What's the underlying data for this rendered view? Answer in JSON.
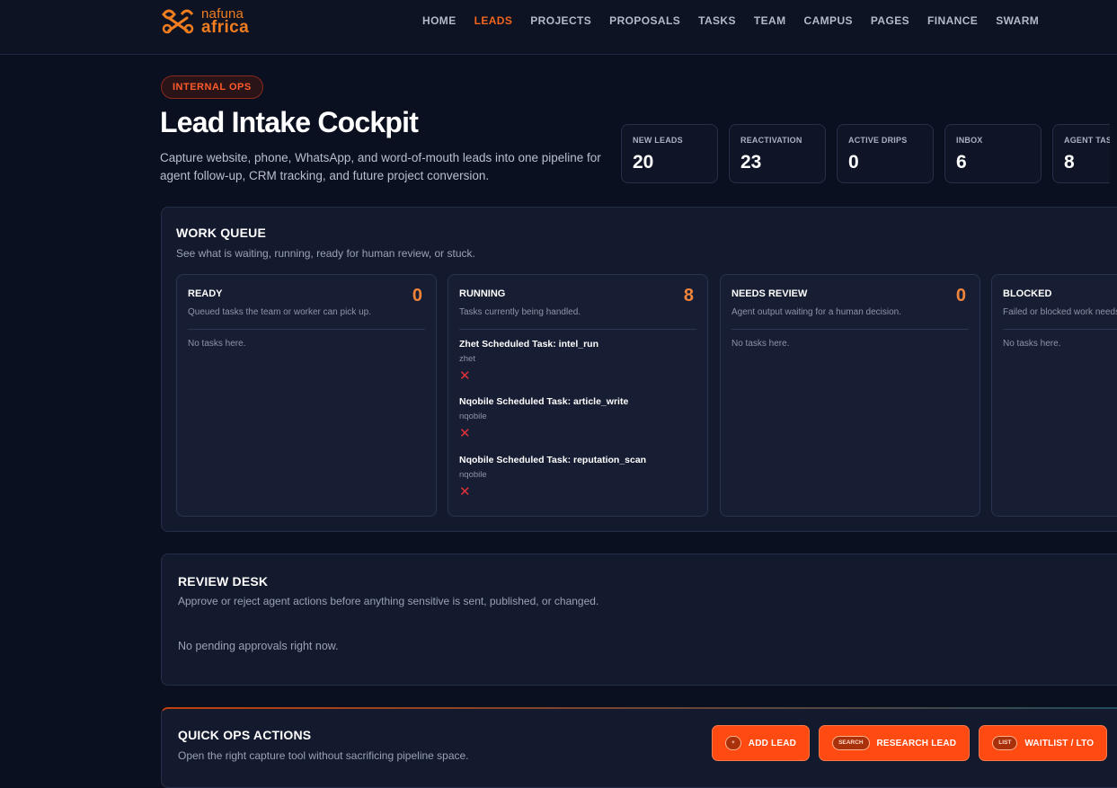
{
  "brand": {
    "line1": "nafuna",
    "line2": "africa",
    "accent": "#f07d1f",
    "icon": "nafuna-logo-icon"
  },
  "nav": {
    "items": [
      {
        "label": "HOME"
      },
      {
        "label": "LEADS",
        "active": true
      },
      {
        "label": "PROJECTS"
      },
      {
        "label": "PROPOSALS"
      },
      {
        "label": "TASKS"
      },
      {
        "label": "TEAM"
      },
      {
        "label": "CAMPUS"
      },
      {
        "label": "PAGES"
      },
      {
        "label": "FINANCE"
      },
      {
        "label": "SWARM"
      }
    ],
    "active_color": "#f0641e"
  },
  "hero": {
    "badge": "INTERNAL OPS",
    "title": "Lead Intake Cockpit",
    "subtitle": "Capture website, phone, WhatsApp, and word-of-mouth leads into one pipeline for agent follow-up, CRM tracking, and future project conversion."
  },
  "stats": [
    {
      "label": "NEW LEADS",
      "value": "20"
    },
    {
      "label": "REACTIVATION",
      "value": "23"
    },
    {
      "label": "ACTIVE DRIPS",
      "value": "0"
    },
    {
      "label": "INBOX",
      "value": "6"
    },
    {
      "label": "AGENT TASKS",
      "value": "8"
    }
  ],
  "work_queue": {
    "title": "WORK QUEUE",
    "description": "See what is waiting, running, ready for human review, or stuck.",
    "columns": [
      {
        "title": "READY",
        "description": "Queued tasks the team or worker can pick up.",
        "count": "0",
        "empty": "No tasks here."
      },
      {
        "title": "RUNNING",
        "description": "Tasks currently being handled.",
        "count": "8",
        "tasks": [
          {
            "name": "Zhet Scheduled Task: intel_run",
            "owner": "zhet",
            "status_icon": "x-icon"
          },
          {
            "name": "Nqobile Scheduled Task: article_write",
            "owner": "nqobile",
            "status_icon": "x-icon"
          },
          {
            "name": "Nqobile Scheduled Task: reputation_scan",
            "owner": "nqobile",
            "status_icon": "x-icon"
          }
        ]
      },
      {
        "title": "NEEDS REVIEW",
        "description": "Agent output waiting for a human decision.",
        "count": "0",
        "empty": "No tasks here."
      },
      {
        "title": "BLOCKED",
        "description": "Failed or blocked work needs attention.",
        "count": "",
        "empty": "No tasks here."
      }
    ]
  },
  "review_desk": {
    "title": "REVIEW DESK",
    "description": "Approve or reject agent actions before anything sensitive is sent, published, or changed.",
    "empty": "No pending approvals right now."
  },
  "quick_ops": {
    "title": "QUICK OPS ACTIONS",
    "description": "Open the right capture tool without sacrificing pipeline space.",
    "buttons": [
      {
        "pill": "+",
        "label": "ADD LEAD"
      },
      {
        "pill": "SEARCH",
        "label": "RESEARCH LEAD"
      },
      {
        "pill": "LIST",
        "label": "WAITLIST / LTO"
      }
    ],
    "button_color": "#ff4a12"
  }
}
